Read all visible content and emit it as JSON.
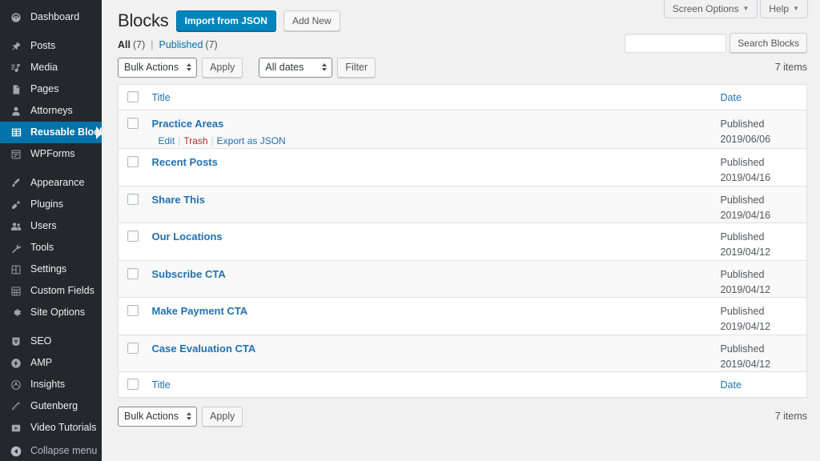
{
  "sidebar": {
    "items": [
      {
        "label": "Dashboard",
        "icon": "dashboard-icon",
        "current": false,
        "sep_after": true
      },
      {
        "label": "Posts",
        "icon": "pin-icon",
        "current": false,
        "sep_after": false
      },
      {
        "label": "Media",
        "icon": "media-icon",
        "current": false,
        "sep_after": false
      },
      {
        "label": "Pages",
        "icon": "pages-icon",
        "current": false,
        "sep_after": false
      },
      {
        "label": "Attorneys",
        "icon": "user-icon",
        "current": false,
        "sep_after": false
      },
      {
        "label": "Reusable Blocks",
        "icon": "grid-icon",
        "current": true,
        "sep_after": false
      },
      {
        "label": "WPForms",
        "icon": "form-icon",
        "current": false,
        "sep_after": true
      },
      {
        "label": "Appearance",
        "icon": "paintbrush-icon",
        "current": false,
        "sep_after": false
      },
      {
        "label": "Plugins",
        "icon": "plug-icon",
        "current": false,
        "sep_after": false
      },
      {
        "label": "Users",
        "icon": "users-icon",
        "current": false,
        "sep_after": false
      },
      {
        "label": "Tools",
        "icon": "wrench-icon",
        "current": false,
        "sep_after": false
      },
      {
        "label": "Settings",
        "icon": "settings-icon",
        "current": false,
        "sep_after": false
      },
      {
        "label": "Custom Fields",
        "icon": "custom-fields-icon",
        "current": false,
        "sep_after": false
      },
      {
        "label": "Site Options",
        "icon": "gear-icon",
        "current": false,
        "sep_after": true
      },
      {
        "label": "SEO",
        "icon": "seo-icon",
        "current": false,
        "sep_after": false
      },
      {
        "label": "AMP",
        "icon": "amp-bolt-icon",
        "current": false,
        "sep_after": false
      },
      {
        "label": "Insights",
        "icon": "insights-icon",
        "current": false,
        "sep_after": false
      },
      {
        "label": "Gutenberg",
        "icon": "pencil-icon",
        "current": false,
        "sep_after": false
      },
      {
        "label": "Video Tutorials",
        "icon": "video-play-icon",
        "current": false,
        "sep_after": false
      }
    ],
    "collapse": {
      "label": "Collapse menu",
      "icon": "collapse-arrow-icon"
    }
  },
  "screen_meta": {
    "screen_options": "Screen Options",
    "help": "Help",
    "caret": "▼"
  },
  "header": {
    "title": "Blocks",
    "import_button": "Import from JSON",
    "add_new_button": "Add New"
  },
  "filters": {
    "all": {
      "label": "All",
      "count": "(7)"
    },
    "published": {
      "label": "Published",
      "count": "(7)"
    },
    "divider": "|"
  },
  "search": {
    "value": "",
    "placeholder": "",
    "submit_label": "Search Blocks"
  },
  "tablenav_top": {
    "bulk_actions": "Bulk Actions",
    "apply": "Apply",
    "dates": "All dates",
    "filter": "Filter",
    "items_count": "7 items"
  },
  "tablenav_bottom": {
    "bulk_actions": "Bulk Actions",
    "apply": "Apply",
    "items_count": "7 items"
  },
  "table": {
    "columns": {
      "title": "Title",
      "date": "Date"
    },
    "rows": [
      {
        "title": "Practice Areas",
        "status": "Published",
        "date": "2019/06/06",
        "actions": {
          "edit": "Edit",
          "trash": "Trash",
          "export": "Export as JSON"
        },
        "has_actions": true
      },
      {
        "title": "Recent Posts",
        "status": "Published",
        "date": "2019/04/16",
        "has_actions": false
      },
      {
        "title": "Share This",
        "status": "Published",
        "date": "2019/04/16",
        "has_actions": false
      },
      {
        "title": "Our Locations",
        "status": "Published",
        "date": "2019/04/12",
        "has_actions": false
      },
      {
        "title": "Subscribe CTA",
        "status": "Published",
        "date": "2019/04/12",
        "has_actions": false
      },
      {
        "title": "Make Payment CTA",
        "status": "Published",
        "date": "2019/04/12",
        "has_actions": false
      },
      {
        "title": "Case Evaluation CTA",
        "status": "Published",
        "date": "2019/04/12",
        "has_actions": false
      }
    ]
  },
  "colors": {
    "sidebar_bg": "#23282d",
    "accent_blue": "#0073aa",
    "link_blue": "#2271b1",
    "primary_button": "#0085ba",
    "trash_red": "#b32d2e",
    "page_bg": "#f1f1f1",
    "row_alt_bg": "#f9f9f9"
  }
}
